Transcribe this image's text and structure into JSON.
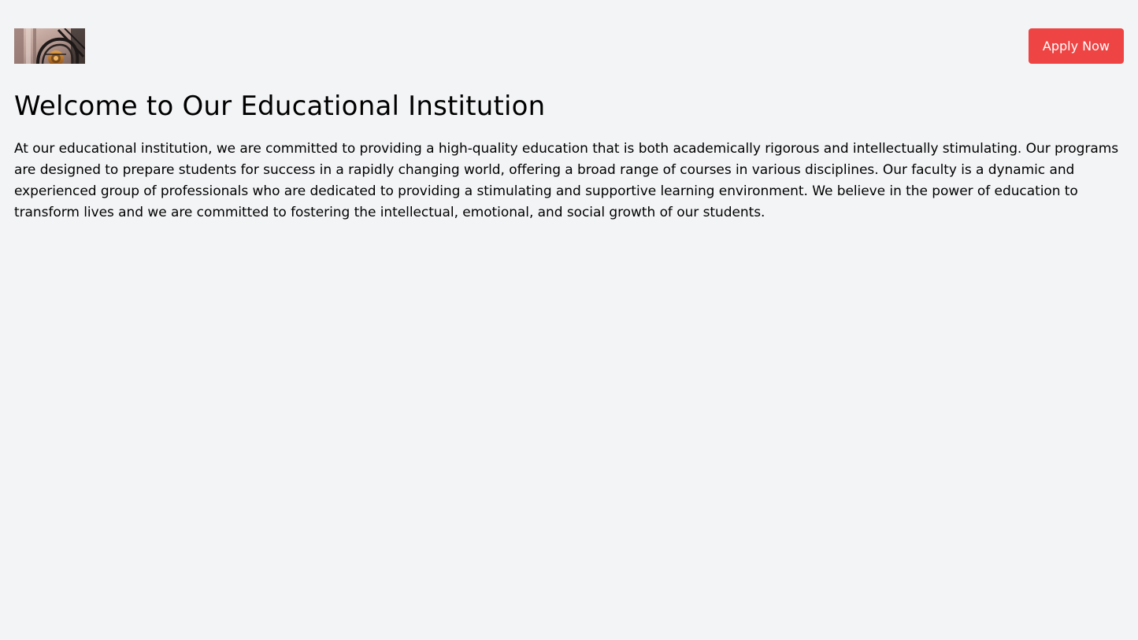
{
  "header": {
    "logo_name": "institution-logo",
    "apply_label": "Apply Now"
  },
  "main": {
    "title": "Welcome to Our Educational Institution",
    "intro": "At our educational institution, we are committed to providing a high-quality education that is both academically rigorous and intellectually stimulating. Our programs are designed to prepare students for success in a rapidly changing world, offering a broad range of courses in various disciplines. Our faculty is a dynamic and experienced group of professionals who are dedicated to providing a stimulating and supportive learning environment. We believe in the power of education to transform lives and we are committed to fostering the intellectual, emotional, and social growth of our students."
  },
  "colors": {
    "background": "#f3f4f6",
    "accent": "#ef4444",
    "text": "#000000"
  }
}
